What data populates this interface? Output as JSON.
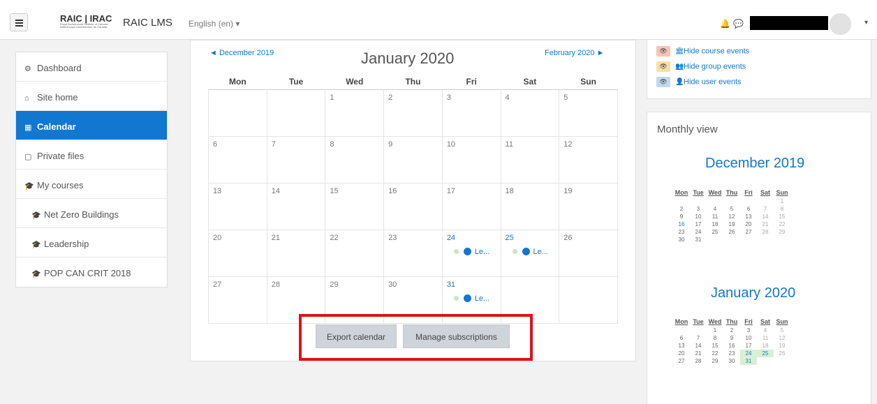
{
  "header": {
    "logo_text": "RAIC | IRAC",
    "logo_sub": "Royal Architectural Institute of Canada · Institut royal d'architecture du Canada",
    "site_name": "RAIC LMS",
    "language": "English (en) ▾",
    "bell_icon": "bell-icon",
    "message_icon": "chat-icon",
    "user_caret": "▾"
  },
  "sidebar": {
    "items": [
      {
        "label": "Dashboard",
        "icon": "dashboard-icon",
        "glyph": "⚙"
      },
      {
        "label": "Site home",
        "icon": "home-icon",
        "glyph": "⌂"
      },
      {
        "label": "Calendar",
        "icon": "calendar-icon",
        "glyph": "▦"
      },
      {
        "label": "Private files",
        "icon": "file-icon",
        "glyph": "▢"
      },
      {
        "label": "My courses",
        "icon": "graduation-cap-icon",
        "glyph": "🎓"
      },
      {
        "label": "Net Zero Buildings",
        "icon": "graduation-cap-icon",
        "glyph": "🎓"
      },
      {
        "label": "Leadership",
        "icon": "graduation-cap-icon",
        "glyph": "🎓"
      },
      {
        "label": "POP CAN CRIT 2018",
        "icon": "graduation-cap-icon",
        "glyph": "🎓"
      }
    ]
  },
  "calendar": {
    "prev": "◄  December 2019",
    "next": "February 2020  ►",
    "title": "January 2020",
    "weekdays": [
      "Mon",
      "Tue",
      "Wed",
      "Thu",
      "Fri",
      "Sat",
      "Sun"
    ],
    "weeks": [
      [
        "",
        "",
        "1",
        "2",
        "3",
        "4",
        "5"
      ],
      [
        "6",
        "7",
        "8",
        "9",
        "10",
        "11",
        "12"
      ],
      [
        "13",
        "14",
        "15",
        "16",
        "17",
        "18",
        "19"
      ],
      [
        "20",
        "21",
        "22",
        "23",
        "24",
        "25",
        "26"
      ],
      [
        "27",
        "28",
        "29",
        "30",
        "31",
        "",
        ""
      ]
    ],
    "event_label": "Le...",
    "export_button": "Export calendar",
    "manage_button": "Manage subscriptions"
  },
  "filters": {
    "items": [
      {
        "label": "Hide course events",
        "icon": "university-icon",
        "glyph": "🏛",
        "color": "#f5c4b9"
      },
      {
        "label": "Hide group events",
        "icon": "users-icon",
        "glyph": "👥",
        "color": "#f7dfa5"
      },
      {
        "label": "Hide user events",
        "icon": "user-icon",
        "glyph": "👤",
        "color": "#c0d9ee"
      }
    ]
  },
  "monthly": {
    "title": "Monthly view",
    "weekdays": [
      "Mon",
      "Tue",
      "Wed",
      "Thu",
      "Fri",
      "Sat",
      "Sun"
    ],
    "months": [
      {
        "name": "December 2019",
        "weeks": [
          [
            "",
            "",
            "",
            "",
            "",
            "",
            "1"
          ],
          [
            "2",
            "3",
            "4",
            "5",
            "6",
            "7",
            "8"
          ],
          [
            "9",
            "10",
            "11",
            "12",
            "13",
            "14",
            "15"
          ],
          [
            "16",
            "17",
            "18",
            "19",
            "20",
            "21",
            "22"
          ],
          [
            "23",
            "24",
            "25",
            "26",
            "27",
            "28",
            "29"
          ],
          [
            "30",
            "31",
            "",
            "",
            "",
            "",
            ""
          ]
        ]
      },
      {
        "name": "January 2020",
        "weeks": [
          [
            "",
            "",
            "1",
            "2",
            "3",
            "4",
            "5"
          ],
          [
            "6",
            "7",
            "8",
            "9",
            "10",
            "11",
            "12"
          ],
          [
            "13",
            "14",
            "15",
            "16",
            "17",
            "18",
            "19"
          ],
          [
            "20",
            "21",
            "22",
            "23",
            "24",
            "25",
            "26"
          ],
          [
            "27",
            "28",
            "29",
            "30",
            "31",
            "",
            ""
          ]
        ]
      }
    ]
  },
  "colors": {
    "accent": "#1177d1",
    "event_dot": "#c9e8c5",
    "highlight_box": "#e0101a"
  }
}
